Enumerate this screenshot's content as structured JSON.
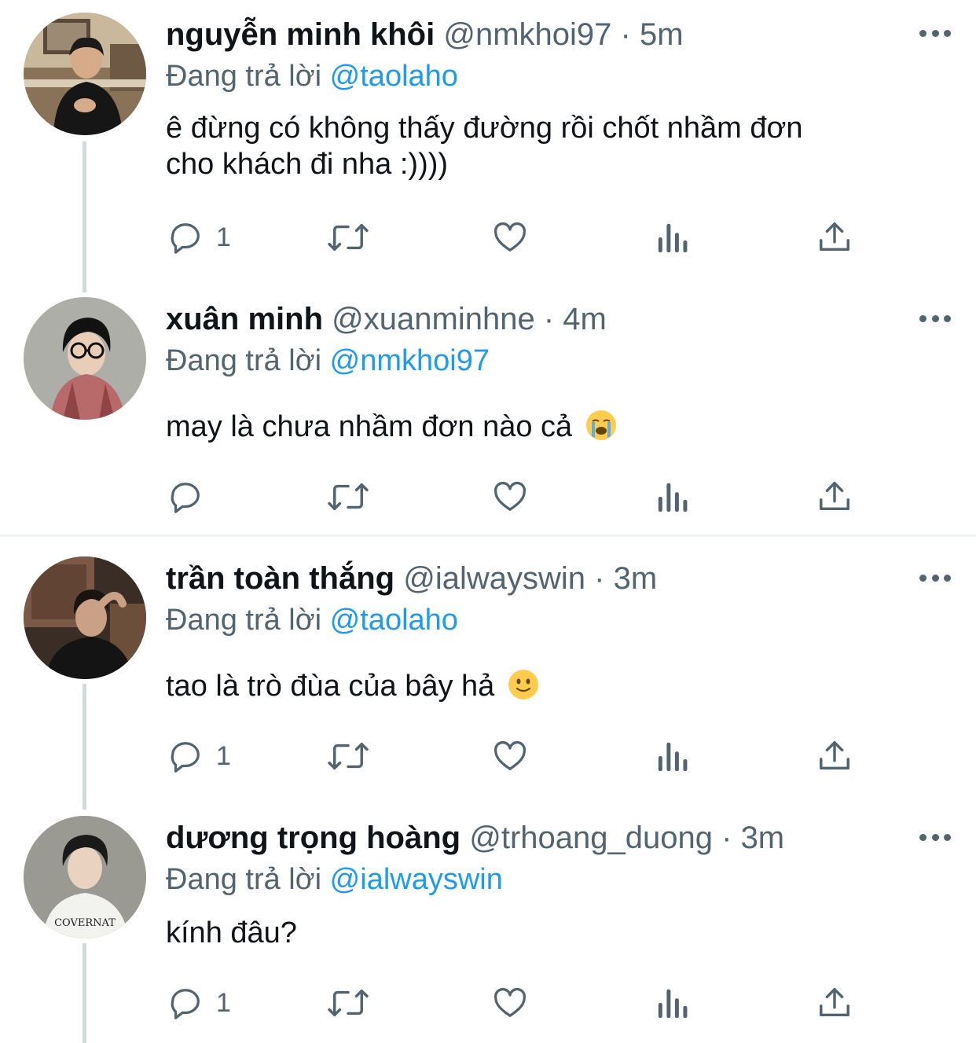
{
  "tweets": [
    {
      "name": "nguyễn minh khôi",
      "handle": "@nmkhoi97",
      "separator": "·",
      "time": "5m",
      "replying_prefix": "Đang trả lời",
      "replying_to": "@taolaho",
      "text_lines": [
        "ê đừng có không thấy đường rồi chốt nhầm đơn",
        "cho khách đi nha :))))"
      ],
      "reply_count": "1",
      "emoji": ""
    },
    {
      "name": "xuân minh",
      "handle": "@xuanminhne",
      "separator": "·",
      "time": "4m",
      "replying_prefix": "Đang trả lời",
      "replying_to": "@nmkhoi97",
      "text_lines": [
        "may là chưa nhầm đơn nào cả"
      ],
      "reply_count": "",
      "emoji": "crying-face-emoji"
    },
    {
      "name": "trần toàn thắng",
      "handle": "@ialwayswin",
      "separator": "·",
      "time": "3m",
      "replying_prefix": "Đang trả lời",
      "replying_to": "@taolaho",
      "text_lines": [
        "tao là trò đùa của bây hả"
      ],
      "reply_count": "1",
      "emoji": "slightly-smiling-face-emoji"
    },
    {
      "name": "dương trọng hoàng",
      "handle": "@trhoang_duong",
      "separator": "·",
      "time": "3m",
      "replying_prefix": "Đang trả lời",
      "replying_to": "@ialwayswin",
      "text_lines": [
        "kính đâu?"
      ],
      "reply_count": "1",
      "emoji": "",
      "avatar_shirt_text": "COVERNAT"
    }
  ],
  "icons": [
    "reply-icon",
    "retweet-icon",
    "like-icon",
    "analytics-icon",
    "share-icon",
    "more-icon"
  ],
  "colors": {
    "link": "#1d9bf0",
    "secondary": "#536471",
    "thread_line": "#cfd9de"
  }
}
